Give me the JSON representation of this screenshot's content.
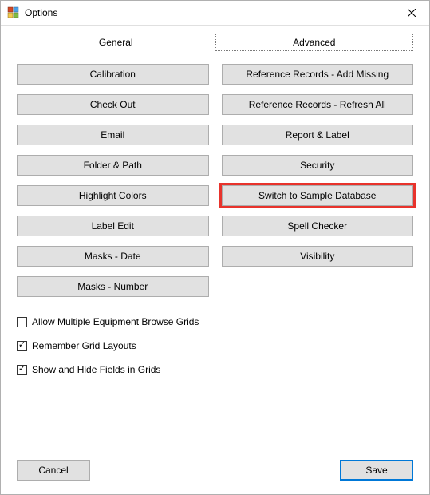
{
  "window": {
    "title": "Options"
  },
  "tabs": {
    "general": "General",
    "advanced": "Advanced",
    "active": "advanced"
  },
  "left_buttons": [
    "Calibration",
    "Check Out",
    "Email",
    "Folder & Path",
    "Highlight Colors",
    "Label Edit",
    "Masks - Date",
    "Masks - Number"
  ],
  "right_buttons": [
    "Reference Records - Add Missing",
    "Reference Records - Refresh All",
    "Report & Label",
    "Security",
    "Switch to Sample Database",
    "Spell Checker",
    "Visibility"
  ],
  "highlighted_right_index": 4,
  "checkboxes": [
    {
      "label": "Allow Multiple Equipment Browse Grids",
      "checked": false
    },
    {
      "label": "Remember Grid Layouts",
      "checked": true
    },
    {
      "label": "Show and Hide Fields in Grids",
      "checked": true
    }
  ],
  "footer": {
    "cancel": "Cancel",
    "save": "Save"
  }
}
